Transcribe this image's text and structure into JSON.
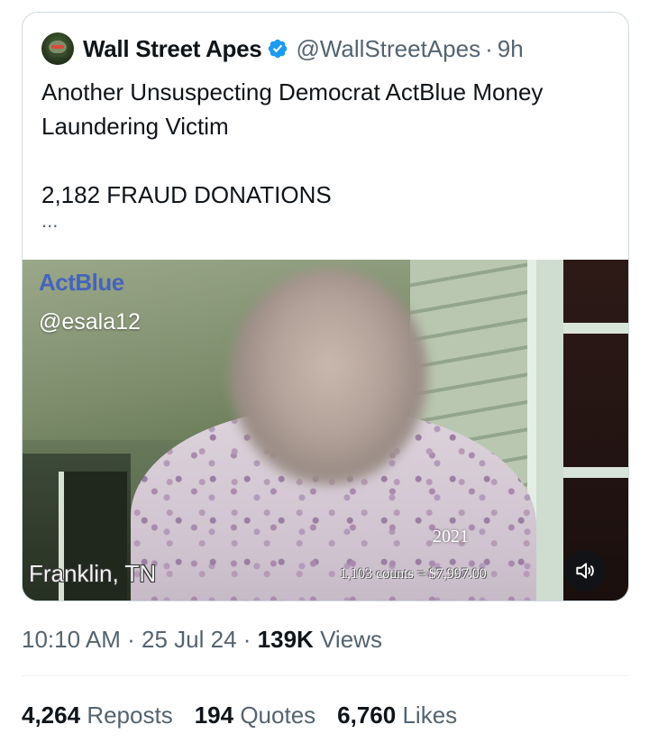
{
  "quoted_tweet": {
    "author": {
      "display_name": "Wall Street Apes",
      "handle": "@WallStreetApes",
      "separator": "·",
      "time_ago": "9h",
      "verified_color": "#1d9bf0"
    },
    "text_lines": [
      "Another Unsuspecting Democrat ActBlue Money",
      "Laundering Victim"
    ],
    "text_line_2": "2,182 FRAUD DONATIONS",
    "ellipsis": "...",
    "media": {
      "watermark": "ActBlue",
      "handle_overlay": "@esala12",
      "location_overlay": "Franklin, TN",
      "year_overlay": "2021",
      "counts_overlay": "1,103 counts = $7,997.00",
      "mute_icon": "volume-icon"
    }
  },
  "meta": {
    "time": "10:10 AM",
    "dot": "·",
    "date": "25 Jul 24",
    "views_count": "139K",
    "views_label": "Views"
  },
  "stats": {
    "reposts_count": "4,264",
    "reposts_label": "Reposts",
    "quotes_count": "194",
    "quotes_label": "Quotes",
    "likes_count": "6,760",
    "likes_label": "Likes"
  }
}
